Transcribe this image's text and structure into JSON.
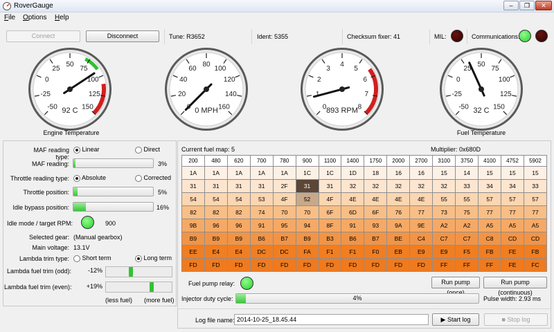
{
  "window": {
    "title": "RoverGauge"
  },
  "menu": [
    {
      "key": "F",
      "rest": "ile"
    },
    {
      "key": "O",
      "rest": "ptions"
    },
    {
      "key": "H",
      "rest": "elp"
    }
  ],
  "toolbar": {
    "connect_label": "Connect",
    "disconnect_label": "Disconnect",
    "tune": "Tune: R3652",
    "ident": "Ident: 5355",
    "checksum": "Checksum fixer: 41",
    "mil_label": "MIL:",
    "comms_label": "Communications:"
  },
  "gauges": [
    {
      "id": "engine-temp",
      "title": "Engine Temperature",
      "readout": "92 C",
      "min": -50,
      "max": 150,
      "value": 92,
      "ticks": [
        "-50",
        "-25",
        "0",
        "25",
        "50",
        "75",
        "100",
        "125",
        "150"
      ],
      "redline_from": 110,
      "green_from": 70,
      "green_to": 90
    },
    {
      "id": "speed",
      "title": "",
      "readout": "0 MPH",
      "min": 0,
      "max": 160,
      "value": 0,
      "ticks": [
        "0",
        "20",
        "40",
        "60",
        "80",
        "100",
        "120",
        "140",
        "160"
      ]
    },
    {
      "id": "rpm",
      "title": "",
      "readout": "893 RPM",
      "min": 0,
      "max": 8,
      "value": 0.893,
      "ticks": [
        "0",
        "1",
        "2",
        "3",
        "4",
        "5",
        "6",
        "7",
        "8"
      ],
      "redline_from": 5.6
    },
    {
      "id": "fuel-temp",
      "title": "Fuel Temperature",
      "readout": "32 C",
      "min": -50,
      "max": 150,
      "value": 32,
      "ticks": [
        "-50",
        "-25",
        "0",
        "25",
        "50",
        "75",
        "100",
        "125",
        "150"
      ]
    }
  ],
  "left": {
    "maf_type_label": "MAF reading type:",
    "maf_linear": "Linear",
    "maf_direct": "Direct",
    "maf_reading_label": "MAF reading:",
    "maf_reading": "3%",
    "maf_fill": 0.03,
    "throttle_type_label": "Throttle reading type:",
    "throttle_absolute": "Absolute",
    "throttle_corrected": "Corrected",
    "throttle_pos_label": "Throttle position:",
    "throttle_pos": "5%",
    "throttle_fill": 0.05,
    "idle_bypass_label": "Idle bypass position:",
    "idle_bypass": "16%",
    "idle_fill": 0.16,
    "idle_mode_label": "Idle mode / target RPM:",
    "idle_target": "900",
    "gear_label": "Selected gear:",
    "gear": "(Manual gearbox)",
    "voltage_label": "Main voltage:",
    "voltage": "13.1V",
    "lambda_type_label": "Lambda trim type:",
    "lambda_short": "Short term",
    "lambda_long": "Long term",
    "trim_odd_label": "Lambda fuel trim (odd):",
    "trim_odd": "-12%",
    "trim_odd_value": -12,
    "trim_even_label": "Lambda fuel trim (even):",
    "trim_even": "+19%",
    "trim_even_value": 19,
    "less_fuel": "(less fuel)",
    "more_fuel": "(more fuel)"
  },
  "fuelmap": {
    "title": "Current fuel map: 5",
    "multiplier": "Multiplier: 0x680D",
    "columns": [
      "200",
      "480",
      "620",
      "700",
      "780",
      "900",
      "1100",
      "1400",
      "1750",
      "2000",
      "2700",
      "3100",
      "3750",
      "4100",
      "4752",
      "5902"
    ],
    "rows": [
      [
        "1A",
        "1A",
        "1A",
        "1A",
        "1A",
        "1C",
        "1C",
        "1D",
        "18",
        "16",
        "16",
        "15",
        "14",
        "15",
        "15",
        "15"
      ],
      [
        "31",
        "31",
        "31",
        "31",
        "2F",
        "31",
        "31",
        "32",
        "32",
        "32",
        "32",
        "32",
        "33",
        "34",
        "34",
        "33"
      ],
      [
        "54",
        "54",
        "54",
        "53",
        "4F",
        "52",
        "4F",
        "4E",
        "4E",
        "4E",
        "4E",
        "55",
        "55",
        "57",
        "57",
        "57"
      ],
      [
        "82",
        "82",
        "82",
        "74",
        "70",
        "70",
        "6F",
        "6D",
        "6F",
        "76",
        "77",
        "73",
        "75",
        "77",
        "77",
        "77"
      ],
      [
        "9B",
        "96",
        "96",
        "91",
        "95",
        "94",
        "8F",
        "91",
        "93",
        "9A",
        "9E",
        "A2",
        "A2",
        "A5",
        "A5",
        "A5"
      ],
      [
        "B9",
        "B9",
        "B9",
        "B6",
        "B7",
        "B9",
        "B3",
        "B6",
        "B7",
        "BE",
        "C4",
        "C7",
        "C7",
        "C8",
        "CD",
        "CD"
      ],
      [
        "EE",
        "E4",
        "E4",
        "DC",
        "DC",
        "FA",
        "F1",
        "F1",
        "F0",
        "EB",
        "E9",
        "E9",
        "F5",
        "FB",
        "FE",
        "FB"
      ],
      [
        "FD",
        "FD",
        "FD",
        "FD",
        "FD",
        "FD",
        "FD",
        "FD",
        "FD",
        "FD",
        "FD",
        "FF",
        "FF",
        "FF",
        "FE",
        "FC"
      ]
    ],
    "row_colors": [
      "#fdf1e6",
      "#fde6d0",
      "#fbd6b2",
      "#f8be86",
      "#f5a966",
      "#f29446",
      "#f07e22",
      "#f07a1e"
    ],
    "selected": [
      1,
      5
    ],
    "neighbor": [
      2,
      5
    ]
  },
  "bottom": {
    "pump_relay_label": "Fuel pump relay:",
    "run_once": "Run pump (once)",
    "run_continuous": "Run pump (continuous)",
    "injector_label": "Injector duty cycle:",
    "injector_value": "4%",
    "injector_fill": 0.04,
    "pulse_width": "Pulse width: 2.93 ms",
    "log_label": "Log file name:",
    "log_file": "2014-10-25_18.45.44",
    "start_log": "Start log",
    "stop_log": "Stop log"
  }
}
